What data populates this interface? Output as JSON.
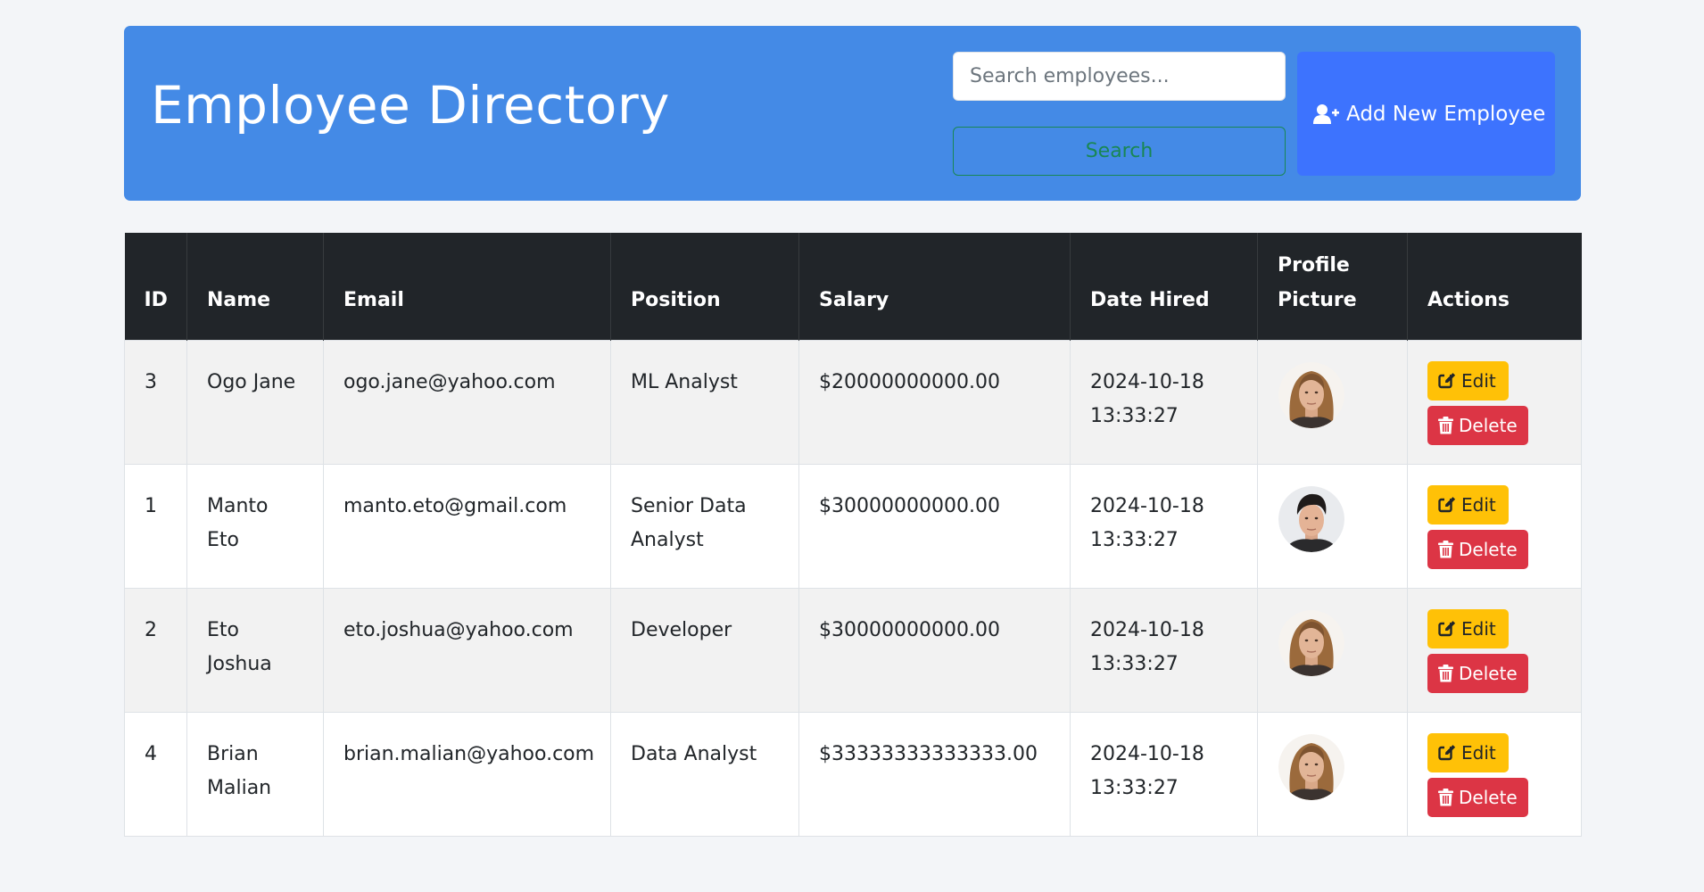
{
  "header": {
    "title": "Employee Directory",
    "search_placeholder": "Search employees...",
    "search_value": "",
    "search_button": "Search",
    "add_button": "Add New Employee",
    "colors": {
      "header_bg": "#448ae6",
      "add_bg": "#3d73fe",
      "search_border": "#198754"
    }
  },
  "table": {
    "columns": [
      "ID",
      "Name",
      "Email",
      "Position",
      "Salary",
      "Date Hired",
      "Profile Picture",
      "Actions"
    ],
    "rows": [
      {
        "id": "3",
        "name": "Ogo Jane",
        "email": "ogo.jane@yahoo.com",
        "position": "ML Analyst",
        "salary": "$20000000000.00",
        "date_hired": "2024-10-18 13:33:27",
        "avatar": "long-hair-avatar",
        "edit_label": "Edit",
        "delete_label": "Delete"
      },
      {
        "id": "1",
        "name": "Manto Eto",
        "email": "manto.eto@gmail.com",
        "position": "Senior Data Analyst",
        "salary": "$30000000000.00",
        "date_hired": "2024-10-18 13:33:27",
        "avatar": "short-hair-avatar",
        "edit_label": "Edit",
        "delete_label": "Delete"
      },
      {
        "id": "2",
        "name": "Eto Joshua",
        "email": "eto.joshua@yahoo.com",
        "position": "Developer",
        "salary": "$30000000000.00",
        "date_hired": "2024-10-18 13:33:27",
        "avatar": "long-hair-avatar",
        "edit_label": "Edit",
        "delete_label": "Delete"
      },
      {
        "id": "4",
        "name": "Brian Malian",
        "email": "brian.malian@yahoo.com",
        "position": "Data Analyst",
        "salary": "$33333333333333.00",
        "date_hired": "2024-10-18 13:33:27",
        "avatar": "long-hair-avatar",
        "edit_label": "Edit",
        "delete_label": "Delete"
      }
    ],
    "colors": {
      "head_bg": "#212529",
      "edit_bg": "#ffc107",
      "delete_bg": "#dc3545",
      "stripe": "#f2f2f2"
    }
  }
}
